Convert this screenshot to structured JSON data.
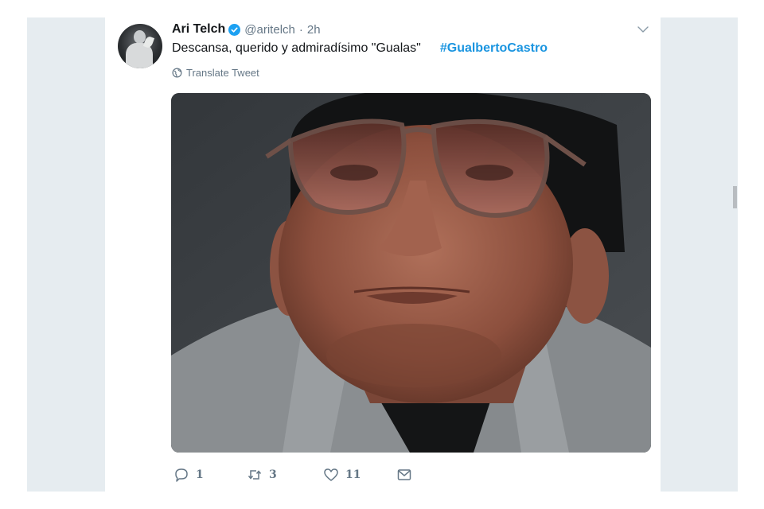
{
  "tweet": {
    "author_name": "Ari Telch",
    "handle": "@aritelch",
    "separator": "·",
    "timestamp": "2h",
    "text": "Descansa, querido y admiradísimo \"Gualas\"",
    "hashtag": "#GualbertoCastro",
    "translate_label": "Translate Tweet",
    "stats": {
      "replies": "1",
      "retweets": "3",
      "likes": "11"
    }
  },
  "icons": {
    "verified": "verified-badge-icon",
    "caret": "chevron-down-icon",
    "translate": "globe-icon",
    "reply": "reply-bubble-icon",
    "retweet": "retweet-icon",
    "like": "heart-icon",
    "dm": "envelope-icon"
  },
  "colors": {
    "hashtag": "#1b95e0",
    "verified": "#1da1f2",
    "muted_text": "#657786",
    "primary_text": "#14171a",
    "page_background": "#e6ecf0"
  }
}
